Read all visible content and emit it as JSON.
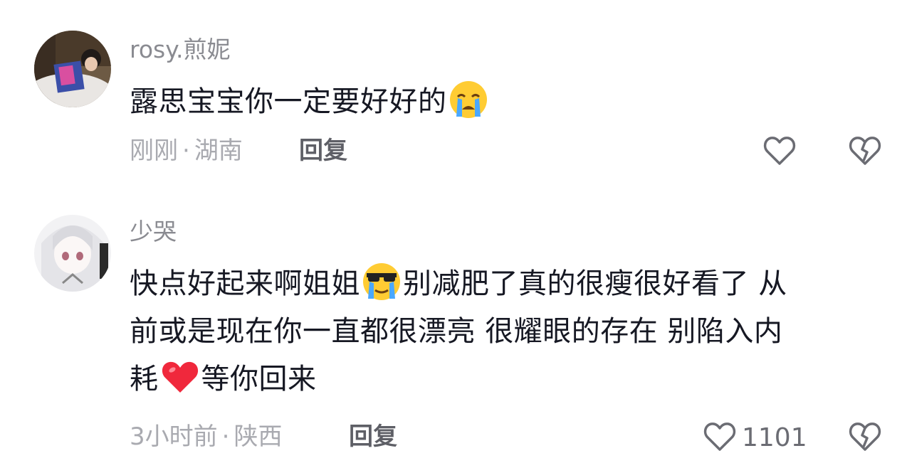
{
  "comments": [
    {
      "username": "rosy.煎妮",
      "text_before_emoji": "露思宝宝你一定要好好的",
      "emoji": "crying-face",
      "time": "刚刚",
      "location": "湖南",
      "separator": "·",
      "reply_label": "回复",
      "like_count": ""
    },
    {
      "username": "少哭",
      "line1_part1": "快点好起来啊姐姐",
      "emoji1": "sunglasses-crying-face",
      "line1_part2": "别减肥了真的很瘦很好看了 从",
      "line2": "前或是现在你一直都很漂亮 很耀眼的存在 别陷入内",
      "line3_part1": "耗",
      "emoji2": "red-heart",
      "line3_part2": "等你回来",
      "time": "3小时前",
      "location": "陕西",
      "separator": "·",
      "reply_label": "回复",
      "like_count": "1101"
    }
  ],
  "colors": {
    "username": "#8a8b91",
    "text": "#161823",
    "meta": "#a9aab0",
    "reply": "#5e5f66",
    "icon": "#6b6c73"
  }
}
